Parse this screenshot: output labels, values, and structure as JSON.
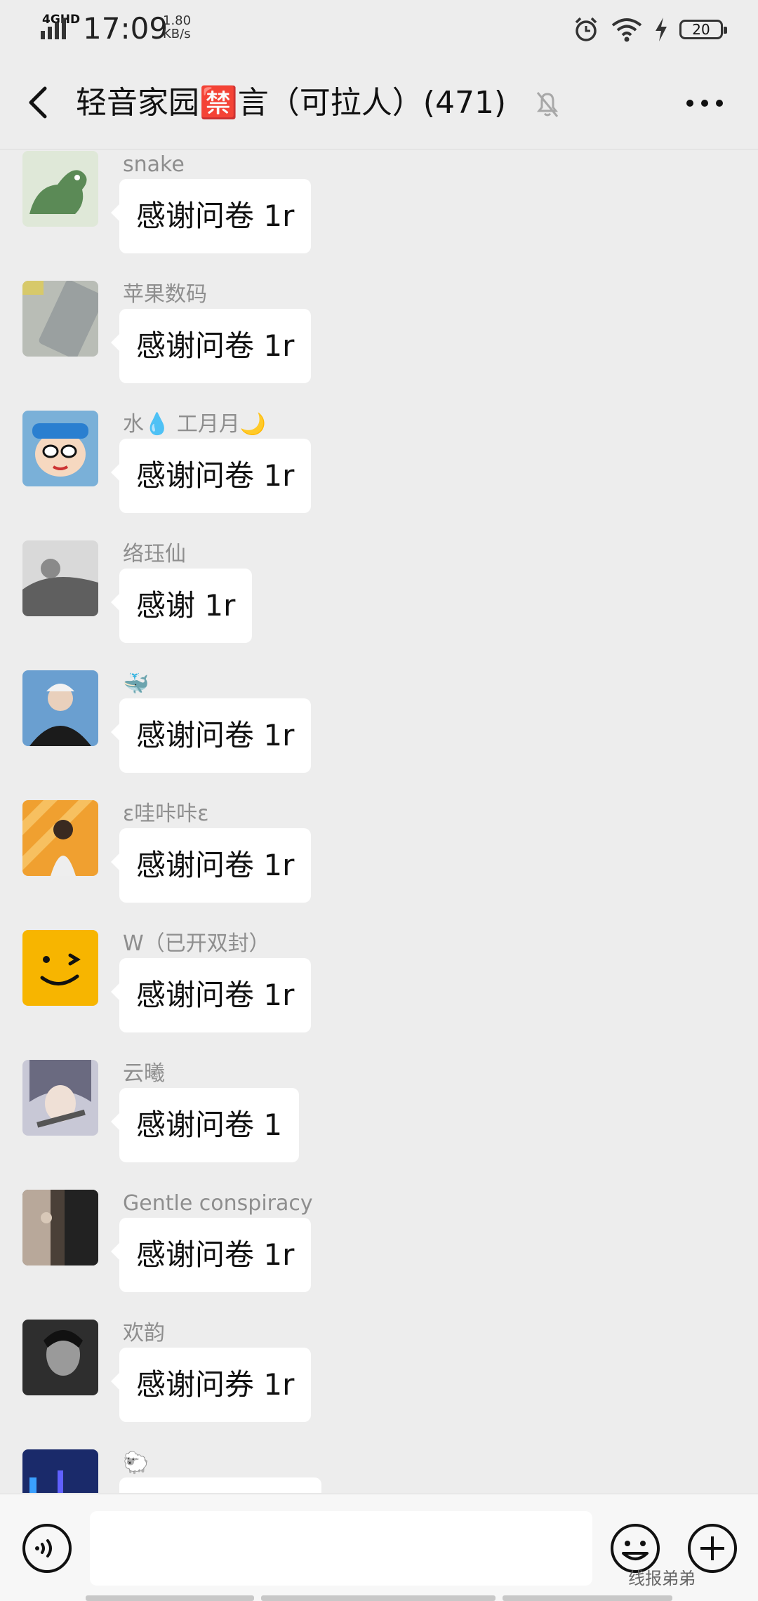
{
  "status_bar": {
    "network": "4GHD",
    "time": "17:09",
    "speed_value": "1.80",
    "speed_unit": "KB/s",
    "battery": "20"
  },
  "header": {
    "title": "轻音家园🈲言（可拉人）(471)"
  },
  "messages": [
    {
      "sender": "snake",
      "text": "感谢问卷 1r",
      "avatar_color": "#5b8a56"
    },
    {
      "sender": "苹果数码",
      "text": "感谢问卷 1r",
      "avatar_color": "#9aa0a0"
    },
    {
      "sender": "水💧 工月月🌙",
      "text": "感谢问卷 1r",
      "avatar_color": "#7ab0d8"
    },
    {
      "sender": "络珏仙",
      "text": "感谢 1r",
      "avatar_color": "#5f5f5f"
    },
    {
      "sender": "🐳",
      "text": "感谢问卷 1r",
      "avatar_color": "#6a9fd0"
    },
    {
      "sender": "ε哇咔咔ε",
      "text": "感谢问卷 1r",
      "avatar_color": "#f0a030"
    },
    {
      "sender": "W（已开双封）",
      "text": "感谢问卷 1r",
      "avatar_color": "#f7b500"
    },
    {
      "sender": "云曦",
      "text": "感谢问卷 1",
      "avatar_color": "#6a6a80"
    },
    {
      "sender": "Gentle conspiracy",
      "text": "感谢问卷 1r",
      "avatar_color": "#4a4038"
    },
    {
      "sender": "欢韵",
      "text": "感谢问券 1r",
      "avatar_color": "#2e2e2e"
    },
    {
      "sender": "🐑",
      "text": "",
      "avatar_color": "#1a2a6a"
    }
  ],
  "input": {
    "watermark": "线报弟弟"
  }
}
